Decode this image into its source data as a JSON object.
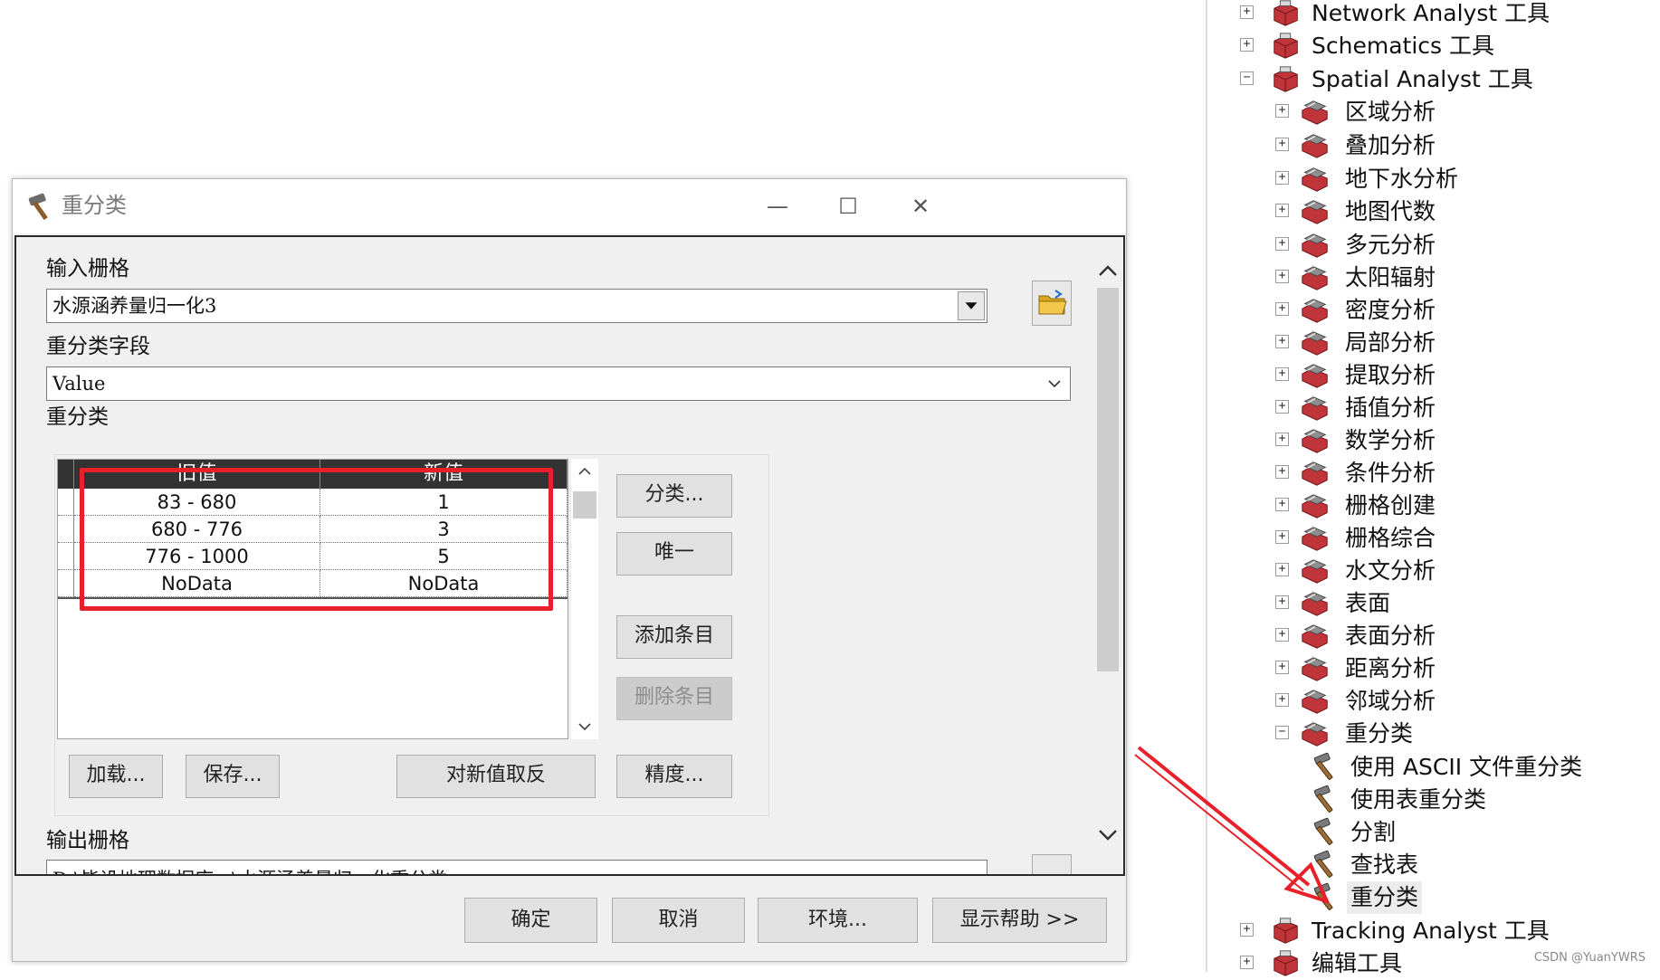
{
  "dialog": {
    "title": "重分类",
    "input_raster_label": "输入栅格",
    "input_raster_value": "水源涵养量归一化3",
    "reclass_field_label": "重分类字段",
    "reclass_field_value": "Value",
    "reclass_label": "重分类",
    "table": {
      "headers": [
        "旧值",
        "新值"
      ],
      "rows": [
        {
          "old": "83 - 680",
          "new": "1"
        },
        {
          "old": "680 - 776",
          "new": "3"
        },
        {
          "old": "776 - 1000",
          "new": "5"
        },
        {
          "old": "NoData",
          "new": "NoData"
        }
      ]
    },
    "buttons": {
      "classify": "分类...",
      "unique": "唯一",
      "add_entry": "添加条目",
      "delete_entry": "删除条目",
      "load": "加载...",
      "save": "保存...",
      "reverse": "对新值取反",
      "precision": "精度..."
    },
    "output_raster_label": "输出栅格",
    "output_raster_value": "D:\\毕设地理数据库...\\水源涵养量归一化重分类",
    "footer": {
      "ok": "确定",
      "cancel": "取消",
      "environments": "环境...",
      "show_help": "显示帮助 >>"
    }
  },
  "tree": {
    "toolsets": [
      {
        "label": "Network Analyst 工具",
        "state": "collapsed"
      },
      {
        "label": "Schematics 工具",
        "state": "collapsed"
      },
      {
        "label": "Spatial Analyst 工具",
        "state": "expanded"
      }
    ],
    "spatial_analyst_children": [
      "区域分析",
      "叠加分析",
      "地下水分析",
      "地图代数",
      "多元分析",
      "太阳辐射",
      "密度分析",
      "局部分析",
      "提取分析",
      "插值分析",
      "数学分析",
      "条件分析",
      "栅格创建",
      "栅格综合",
      "水文分析",
      "表面",
      "表面分析",
      "距离分析",
      "邻域分析",
      "重分类"
    ],
    "reclass_tools": [
      "使用 ASCII 文件重分类",
      "使用表重分类",
      "分割",
      "查找表",
      "重分类"
    ],
    "bottom_toolsets": [
      "Tracking Analyst 工具",
      "编辑工具"
    ]
  },
  "colors": {
    "highlight_box": "#e8202a",
    "arrow": "#e8202a",
    "toolbox_icon": "#c0353a"
  },
  "icons": {
    "title": "hammer-icon",
    "browse": "open-folder-icon",
    "toolbox": "toolbox-icon",
    "toolset": "toolset-icon",
    "tool": "hammer-icon"
  },
  "watermark": "CSDN @YuanYWRS"
}
